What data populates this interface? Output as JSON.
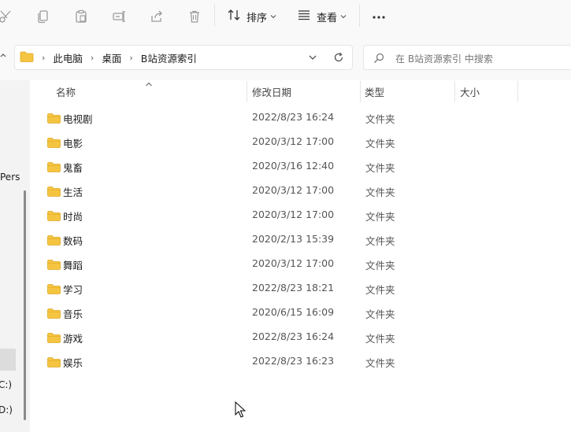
{
  "toolbar": {
    "sort_label": "排序",
    "view_label": "查看",
    "icons": [
      "cut-icon",
      "copy-icon",
      "paste-icon",
      "rename-icon",
      "share-icon",
      "delete-icon",
      "sort-icon",
      "view-icon",
      "more-icon"
    ]
  },
  "address": {
    "breadcrumbs": [
      "此电脑",
      "桌面",
      "B站资源索引"
    ]
  },
  "search": {
    "placeholder": "在 B站资源索引 中搜索"
  },
  "nav": {
    "partial_items": [
      "Pers",
      "C:)",
      "D:)"
    ]
  },
  "columns": {
    "name": "名称",
    "date": "修改日期",
    "type": "类型",
    "size": "大小"
  },
  "files": [
    {
      "name": "电视剧",
      "date": "2022/8/23 16:24",
      "type": "文件夹"
    },
    {
      "name": "电影",
      "date": "2020/3/12 17:00",
      "type": "文件夹"
    },
    {
      "name": "鬼畜",
      "date": "2020/3/16 12:40",
      "type": "文件夹"
    },
    {
      "name": "生活",
      "date": "2020/3/12 17:00",
      "type": "文件夹"
    },
    {
      "name": "时尚",
      "date": "2020/3/12 17:00",
      "type": "文件夹"
    },
    {
      "name": "数码",
      "date": "2020/2/13 15:39",
      "type": "文件夹"
    },
    {
      "name": "舞蹈",
      "date": "2020/3/12 17:00",
      "type": "文件夹"
    },
    {
      "name": "学习",
      "date": "2022/8/23 18:21",
      "type": "文件夹"
    },
    {
      "name": "音乐",
      "date": "2020/6/15 16:09",
      "type": "文件夹"
    },
    {
      "name": "游戏",
      "date": "2022/8/23 16:24",
      "type": "文件夹"
    },
    {
      "name": "娱乐",
      "date": "2022/8/23 16:23",
      "type": "文件夹"
    }
  ],
  "colors": {
    "folder": "#f5c542",
    "folder_dark": "#e0a820"
  }
}
